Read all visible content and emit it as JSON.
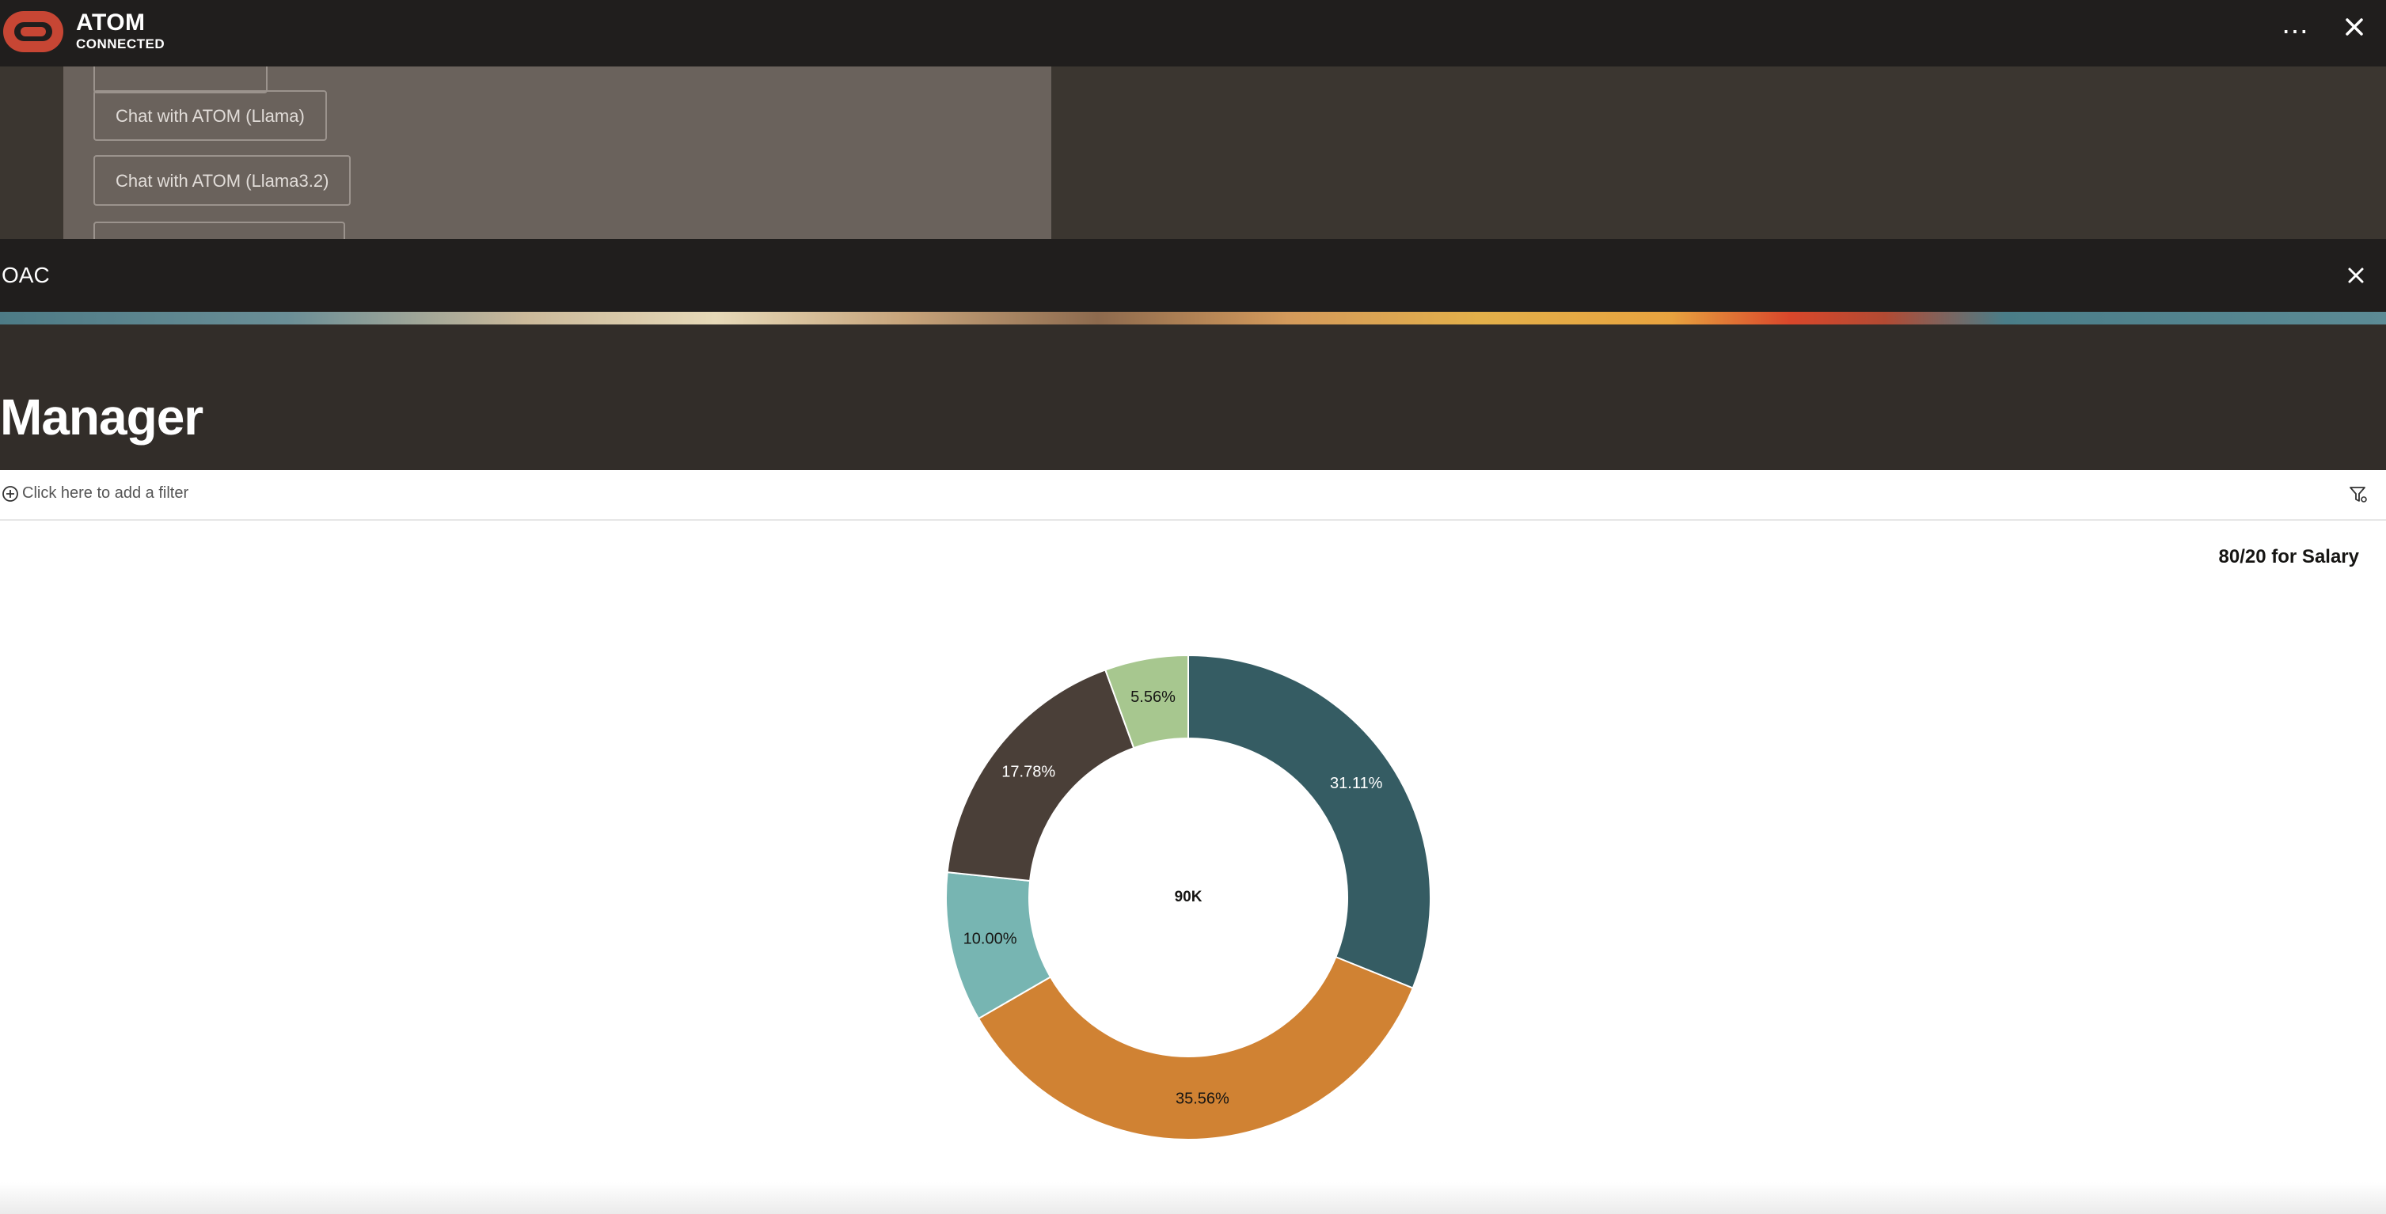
{
  "app": {
    "name": "ATOM",
    "status": "CONNECTED"
  },
  "icons": {
    "logo": "atom-logo",
    "more": "more-horizontal-icon",
    "close": "close-icon",
    "add": "add-circle-icon",
    "filter": "filter-settings-icon"
  },
  "chat": {
    "buttons": [
      {
        "label": "Chat with ATOM (Llama)"
      },
      {
        "label": "Chat with ATOM (Llama3.2)"
      }
    ]
  },
  "oac": {
    "title": "OAC"
  },
  "page": {
    "heading": "Manager"
  },
  "filter": {
    "placeholder": "Click here to add a filter"
  },
  "colors": {
    "brand": "#c74634",
    "teal_dark": "#355c63",
    "orange": "#d08233",
    "teal_light": "#77b5b2",
    "brown": "#4a3f38",
    "green": "#a7c78f"
  },
  "chart_data": {
    "type": "pie",
    "variant": "donut",
    "title": "80/20 for Salary",
    "center_label": "90K",
    "slices": [
      {
        "label": "31.11%",
        "value": 31.11,
        "color": "#355c63",
        "label_color": "#ffffff"
      },
      {
        "label": "35.56%",
        "value": 35.56,
        "color": "#d08233",
        "label_color": "#161513"
      },
      {
        "label": "10.00%",
        "value": 10.0,
        "color": "#77b5b2",
        "label_color": "#161513"
      },
      {
        "label": "17.78%",
        "value": 17.78,
        "color": "#4a3f38",
        "label_color": "#ffffff"
      },
      {
        "label": "5.56%",
        "value": 5.56,
        "color": "#a7c78f",
        "label_color": "#161513"
      }
    ]
  }
}
